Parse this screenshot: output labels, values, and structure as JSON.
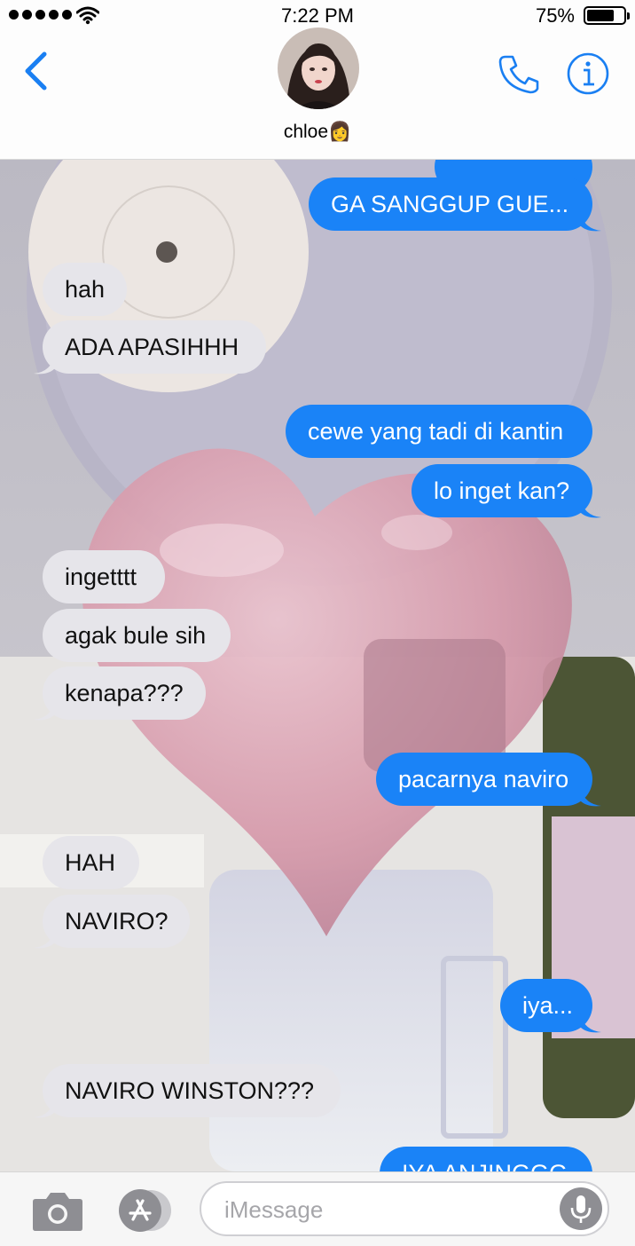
{
  "status_bar": {
    "time": "7:22 PM",
    "battery_percent": "75%",
    "battery_level": 0.75,
    "signal_bars": 5,
    "icons": [
      "signal-dots-icon",
      "wifi-icon",
      "battery-icon"
    ]
  },
  "header": {
    "contact_name": "chloe👩",
    "icons": [
      "back-chevron-icon",
      "contact-avatar",
      "phone-icon",
      "info-icon"
    ]
  },
  "messages": [
    {
      "side": "out",
      "text": ""
    },
    {
      "side": "out",
      "text": "GA SANGGUP GUE..."
    },
    {
      "side": "in",
      "text": "hah"
    },
    {
      "side": "in",
      "text": "ADA APASIHHH"
    },
    {
      "side": "out",
      "text": "cewe yang tadi di kantin"
    },
    {
      "side": "out",
      "text": "lo inget kan?"
    },
    {
      "side": "in",
      "text": "ingetttt"
    },
    {
      "side": "in",
      "text": "agak bule sih"
    },
    {
      "side": "in",
      "text": "kenapa???"
    },
    {
      "side": "out",
      "text": "pacarnya naviro"
    },
    {
      "side": "in",
      "text": "HAH"
    },
    {
      "side": "in",
      "text": "NAVIRO?"
    },
    {
      "side": "out",
      "text": "iya..."
    },
    {
      "side": "in",
      "text": "NAVIRO WINSTON???"
    },
    {
      "side": "out",
      "text": "IYA ANJINGGG"
    }
  ],
  "input_bar": {
    "placeholder": "iMessage",
    "icons": [
      "camera-icon",
      "app-store-icon",
      "microphone-icon"
    ]
  },
  "colors": {
    "outgoing_bubble": "#1a83f7",
    "incoming_bubble": "#e6e5ea",
    "accent": "#1a7ff2"
  }
}
